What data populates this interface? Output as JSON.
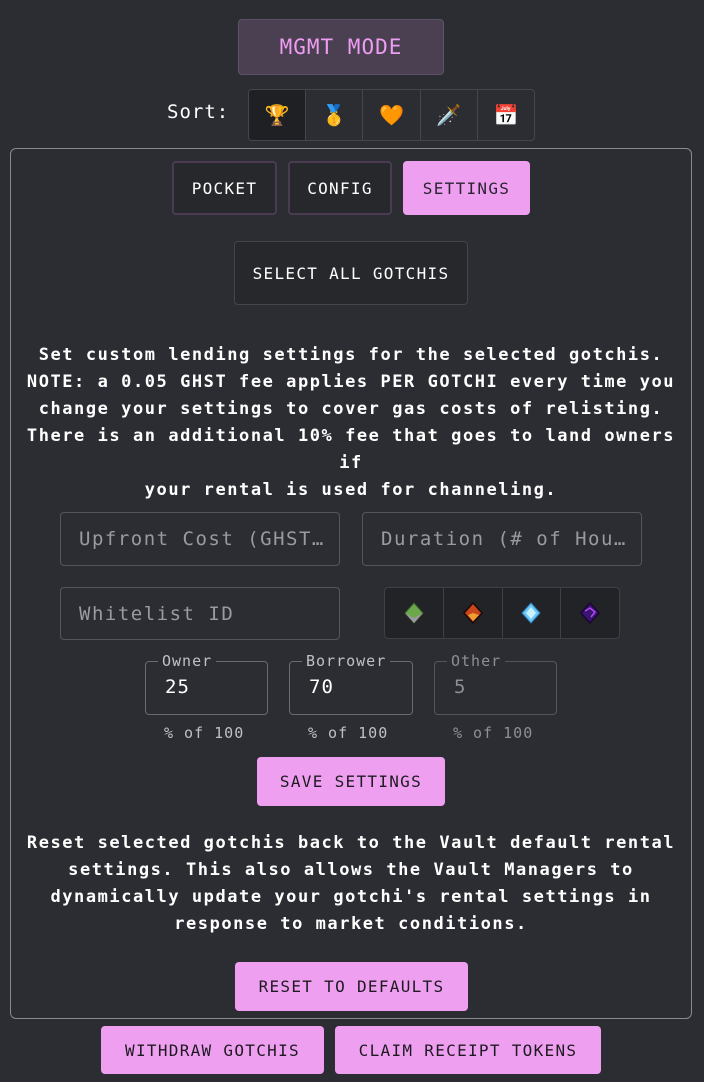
{
  "header": {
    "mode_button": "MGMT MODE",
    "sort_label": "Sort:",
    "sort_options": [
      {
        "icon": "trophy-icon",
        "glyph": "🏆"
      },
      {
        "icon": "medal-icon",
        "glyph": "🥇"
      },
      {
        "icon": "heart-icon",
        "glyph": "🧡"
      },
      {
        "icon": "dagger-icon",
        "glyph": "🗡️"
      },
      {
        "icon": "calendar-icon",
        "glyph": "📅"
      }
    ]
  },
  "tabs": [
    {
      "label": "POCKET"
    },
    {
      "label": "CONFIG"
    },
    {
      "label": "SETTINGS",
      "active": true
    }
  ],
  "select_all": "SELECT ALL GOTCHIS",
  "description": [
    "Set custom lending settings for the selected gotchis.",
    "NOTE: a 0.05 GHST fee applies PER GOTCHI every time you",
    "change your settings to cover gas costs of relisting.",
    "There is an additional 10% fee that goes to land owners if",
    "your rental is used for channeling."
  ],
  "inputs": {
    "upfront_placeholder": "Upfront Cost (GHST…",
    "duration_placeholder": "Duration (# of Hou…",
    "whitelist_placeholder": "Whitelist ID"
  },
  "gems": [
    "fud-alchemica-icon",
    "fomo-alchemica-icon",
    "alpha-alchemica-icon",
    "kek-alchemica-icon"
  ],
  "split": {
    "owner": {
      "label": "Owner",
      "value": "25"
    },
    "borrower": {
      "label": "Borrower",
      "value": "70"
    },
    "other": {
      "label": "Other",
      "value": "5"
    },
    "hint": "% of 100"
  },
  "save": "SAVE SETTINGS",
  "reset_description": [
    "Reset selected gotchis back to the Vault default rental",
    "settings. This also allows the Vault Managers to",
    "dynamically update your gotchi's rental settings in",
    "response to market conditions."
  ],
  "reset": "RESET TO DEFAULTS",
  "footer": {
    "withdraw": "WITHDRAW GOTCHIS",
    "claim": "CLAIM RECEIPT TOKENS"
  },
  "colors": {
    "accent": "#ef9ff0",
    "background": "#2c2d32"
  }
}
